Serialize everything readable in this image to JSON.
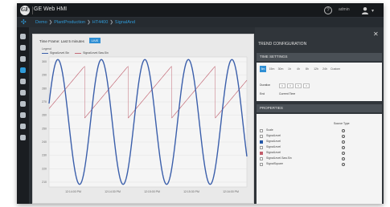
{
  "app": {
    "title": "GE Web HMI",
    "logo_text": "GE"
  },
  "topbar": {
    "help_glyph": "?",
    "user_text": "admin",
    "caret": "▾"
  },
  "breadcrumb": [
    "Demo",
    "PlantProduction",
    "HT4400",
    "SignalAnd"
  ],
  "sidebar": {
    "icons": [
      "home-icon",
      "list-icon",
      "alarm-icon",
      "trend-icon",
      "settings-icon",
      "tag-icon",
      "report-icon",
      "user-icon",
      "tools-icon",
      "help-icon"
    ],
    "active_index": 3
  },
  "chart": {
    "time_label": "Time Frame:  Last 5 minutes",
    "live_label": "LIVE",
    "legend_title": "Legend",
    "legend": [
      {
        "name": "SignalLevel.Sin",
        "color": "#3b5fab"
      },
      {
        "name": "SignalLevel.Saw.Sin",
        "color": "#c46b78"
      }
    ],
    "y_ticks": [
      "300",
      "290",
      "280",
      "270",
      "260",
      "250",
      "240",
      "230",
      "220",
      "210"
    ],
    "x_ticks": [
      "12:14:00 PM",
      "12:14:30 PM",
      "12:15:00 PM",
      "12:15:30 PM",
      "12:16:00 PM"
    ]
  },
  "chart_data": {
    "type": "line",
    "x": [
      0,
      4,
      8,
      12,
      16,
      20,
      24,
      28,
      32,
      36,
      40,
      44,
      48,
      52,
      56,
      60,
      64,
      68,
      72,
      76,
      80,
      84,
      88,
      92,
      96,
      100,
      104,
      108,
      112,
      116,
      120,
      124,
      128,
      132,
      136,
      140,
      144,
      148,
      152,
      156,
      160,
      164,
      168,
      172,
      176,
      180,
      184,
      188,
      192,
      196,
      200
    ],
    "series": [
      {
        "name": "SignalLevel.Sin",
        "color": "#3b5fab",
        "kind": "sine",
        "center": 255,
        "amplitude": 48,
        "period": 44,
        "phase": 0.3
      },
      {
        "name": "SignalLevel.Saw.Sin",
        "color": "#c46b78",
        "kind": "sawtooth",
        "low": 258,
        "high": 298,
        "period": 44,
        "offset": 8
      }
    ],
    "ylim": [
      205,
      305
    ],
    "grid": true,
    "legend_position": "top-left"
  },
  "config": {
    "title": "TREND CONFIGURATION",
    "time_settings_label": "TIME SETTINGS",
    "range_buttons": [
      "5m",
      "15m",
      "30m",
      "1h",
      "4h",
      "8h",
      "12h",
      "24h",
      "Custom"
    ],
    "selected_range": 0,
    "duration_label": "Duration",
    "duration_values": [
      "0",
      "0",
      "5",
      "0"
    ],
    "end_label": "End",
    "end_value": "Current Time",
    "properties_label": "PROPERTIES",
    "source_type_label": "Source Type",
    "properties": [
      {
        "name": "Scale",
        "check": "off"
      },
      {
        "name": "SignalLevel",
        "check": "off"
      },
      {
        "name": "SignalLevel",
        "check": "blue"
      },
      {
        "name": "SignalLevel",
        "check": "off"
      },
      {
        "name": "SignalLevel",
        "check": "red"
      },
      {
        "name": "SignalLevel.Saw.Sin",
        "check": "off"
      },
      {
        "name": "SignalSquare",
        "check": "off"
      }
    ]
  }
}
